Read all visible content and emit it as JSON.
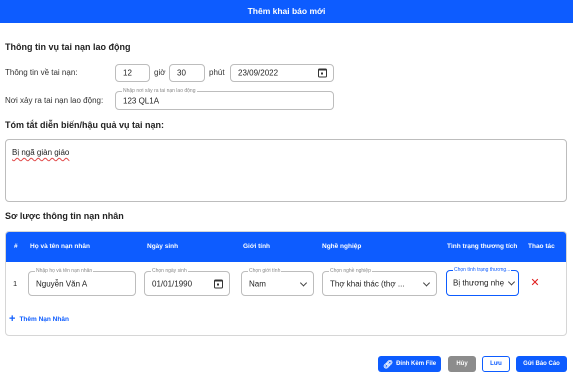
{
  "header": {
    "title": "Thêm khai báo mới"
  },
  "accident": {
    "section_title": "Thông tin vụ tai nạn lao động",
    "time_label": "Thông tin về tai nạn:",
    "hour": "12",
    "hour_unit": "giờ",
    "minute": "30",
    "minute_unit": "phút",
    "date": "23/09/2022",
    "place_label": "Nơi xảy ra tai nạn lao động:",
    "place_float_label": "Nhập nơi xảy ra tai nạn lao động",
    "place_value": "123 QL1A"
  },
  "summary": {
    "title": "Tóm tắt diễn biến/hậu quả vụ tai nạn:",
    "value": "Bị ngã giàn giáo"
  },
  "victims": {
    "section_title": "Sơ lược thông tin nạn nhân",
    "columns": [
      "#",
      "Họ và tên nạn nhân",
      "Ngày sinh",
      "Giới tính",
      "Nghề nghiệp",
      "Tình trạng thương tích",
      "Thao tác"
    ],
    "rows": [
      {
        "index": "1",
        "name_label": "Nhập họ và tên nạn nhân",
        "name": "Nguyễn Văn A",
        "dob_label": "Chọn ngày sinh",
        "dob": "01/01/1990",
        "gender_label": "Chọn giới tính",
        "gender": "Nam",
        "job_label": "Chọn nghề nghiệp",
        "job": "Thợ khai thác (thợ ...",
        "injury_label": "Chọn tình trạng thương...",
        "injury": "Bị thương nhẹ"
      }
    ],
    "add_label": "Thêm Nạn Nhân"
  },
  "actions": {
    "attach": "Đính Kèm File",
    "cancel": "Hủy",
    "save": "Lưu",
    "submit": "Gửi Báo Cáo"
  },
  "icons": {
    "calendar": "calendar-icon",
    "chevron": "chevron-down-icon",
    "remove": "close-icon",
    "add": "plus-icon",
    "attach": "paperclip-icon"
  },
  "colors": {
    "primary": "#0d5cff",
    "danger": "#e02020",
    "neutral_button": "#8c8c8c"
  }
}
